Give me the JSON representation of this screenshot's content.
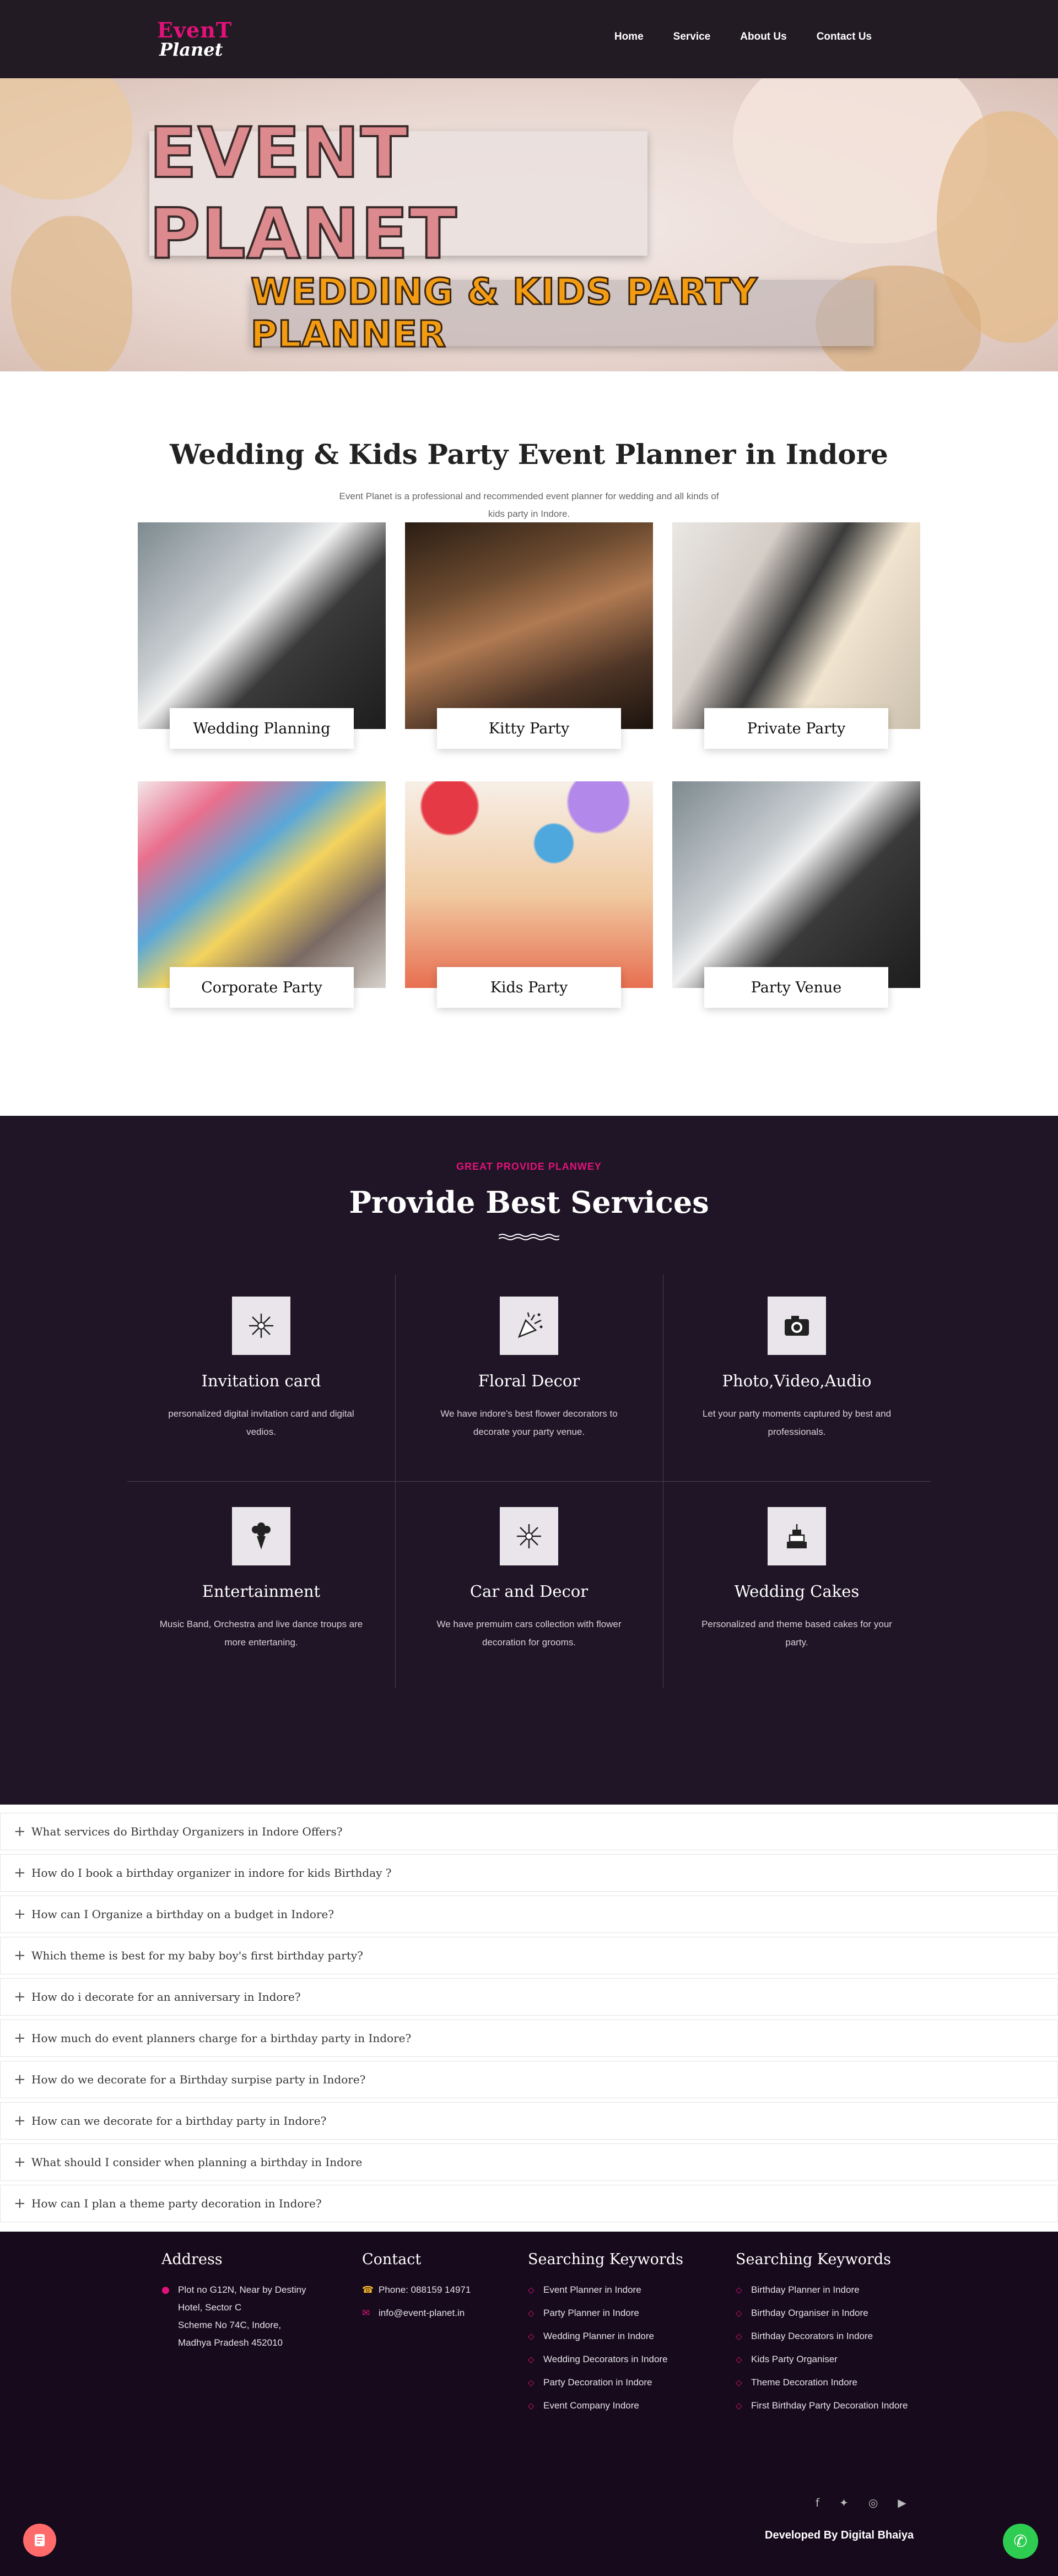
{
  "nav": {
    "logo_line1": "EvenT",
    "logo_line2": "Planet",
    "items": [
      "Home",
      "Service",
      "About Us",
      "Contact Us"
    ]
  },
  "hero": {
    "title": "EVENT PLANET",
    "subtitle": "WEDDING & KIDS PARTY PLANNER"
  },
  "intro": {
    "title": "Wedding & Kids Party Event Planner in Indore",
    "text": "Event Planet is a professional and recommended event planner for wedding and all kinds of kids party in Indore."
  },
  "gallery": [
    {
      "label": "Wedding Planning"
    },
    {
      "label": "Kitty Party"
    },
    {
      "label": "Private Party"
    },
    {
      "label": "Corporate Party"
    },
    {
      "label": "Kids Party"
    },
    {
      "label": "Party Venue"
    }
  ],
  "services": {
    "kicker": "GREAT PROVIDE PLANWEY",
    "title": "Provide Best Services",
    "items": [
      {
        "name": "Invitation card",
        "desc": "personalized digital invitation card and digital vedios.",
        "icon": "fireworks-icon"
      },
      {
        "name": "Floral Decor",
        "desc": "We have indore's best flower decorators to decorate your party venue.",
        "icon": "party-popper-icon"
      },
      {
        "name": "Photo,Video,Audio",
        "desc": "Let your party moments captured by best and professionals.",
        "icon": "camera-icon"
      },
      {
        "name": "Entertainment",
        "desc": "Music Band, Orchestra and live dance troups are more entertaning.",
        "icon": "bouquet-icon"
      },
      {
        "name": "Car and Decor",
        "desc": "We have premuim cars collection with flower decoration for grooms.",
        "icon": "fireworks-icon"
      },
      {
        "name": "Wedding Cakes",
        "desc": "Personalized and theme based cakes for your party.",
        "icon": "cake-icon"
      }
    ]
  },
  "faq": [
    "What services do Birthday Organizers in Indore Offers?",
    "How do I book a birthday organizer in indore for kids Birthday ?",
    "How can I Organize a birthday on a budget in Indore?",
    "Which theme is best for my baby boy's first birthday party?",
    "How do i decorate for an anniversary in Indore?",
    "How much do event planners charge for a birthday party in Indore?",
    "How do we decorate for a Birthday surpise party in Indore?",
    "How can we decorate for a birthday party in Indore?",
    "What should I consider when planning a birthday in Indore",
    "How can I plan a theme party decoration in Indore?"
  ],
  "footer": {
    "address_title": "Address",
    "address_lines": [
      "Plot no G12N, Near by Destiny",
      "Hotel, Sector C",
      "Scheme No 74C, Indore,",
      "Madhya Pradesh 452010"
    ],
    "contact_title": "Contact",
    "phone": "Phone: 088159 14971",
    "email": "info@event-planet.in",
    "kw1_title": "Searching Keywords",
    "kw1": [
      "Event Planner in Indore",
      "Party Planner in Indore",
      "Wedding Planner in Indore",
      "Wedding Decorators in Indore",
      "Party Decoration in Indore",
      "Event Company Indore"
    ],
    "kw2_title": "Searching Keywords",
    "kw2": [
      "Birthday Planner in Indore",
      "Birthday Organiser in Indore",
      "Birthday Decorators in Indore",
      "Kids Party Organiser",
      "Theme Decoration Indore",
      "First Birthday Party Decoration Indore"
    ],
    "developed": "Developed By Digital Bhaiya"
  },
  "colors": {
    "accent": "#e2127a",
    "dark": "#1f1526",
    "footer": "#160a1c",
    "whatsapp": "#2ecc51"
  }
}
